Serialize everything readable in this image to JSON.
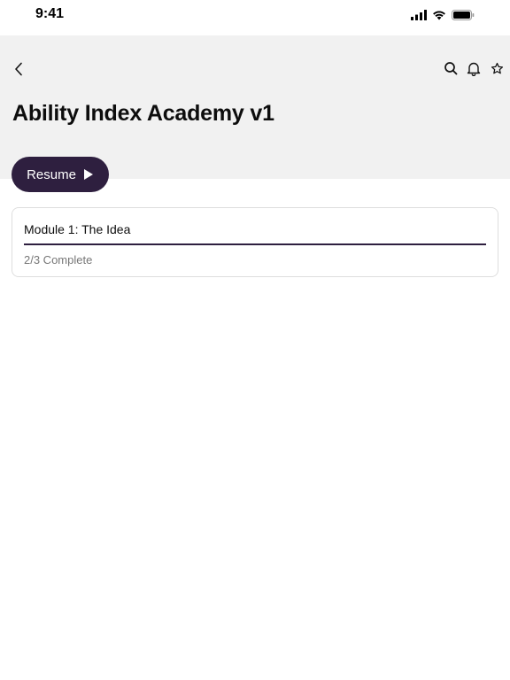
{
  "status_bar": {
    "time": "9:41",
    "icons": [
      "cellular-signal-icon",
      "wifi-icon",
      "battery-icon"
    ]
  },
  "header": {
    "back_icon": "chevron-left-icon",
    "actions": [
      "search-icon",
      "bell-icon",
      "star-icon"
    ],
    "title": "Ability Index Academy v1"
  },
  "resume_button": {
    "label": "Resume",
    "icon": "play-icon"
  },
  "modules": [
    {
      "title": "Module 1: The Idea",
      "status": "2/3 Complete",
      "progress": 1.0
    }
  ],
  "colors": {
    "accent": "#2e1f3f",
    "header_bg": "#f1f1f1",
    "card_border": "#dedede",
    "muted_text": "#777777"
  }
}
